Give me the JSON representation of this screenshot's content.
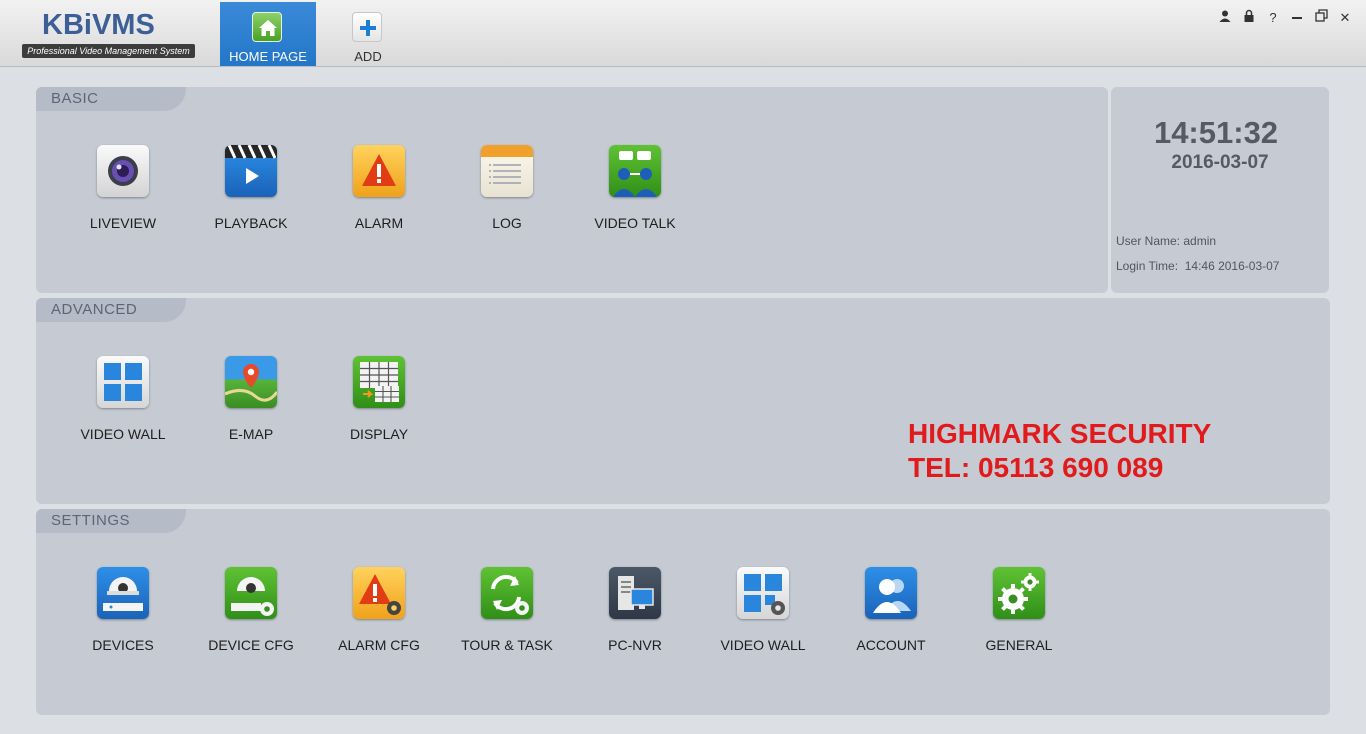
{
  "app": {
    "logo": "KBiVMS",
    "tagline": "Professional Video Management System"
  },
  "nav": {
    "home": "HOME PAGE",
    "add": "ADD"
  },
  "window_controls": [
    "user-icon",
    "lock-icon",
    "help-icon",
    "minimize-icon",
    "restore-icon",
    "close-icon"
  ],
  "basic": {
    "title": "BASIC",
    "items": [
      {
        "label": "LIVEVIEW",
        "icon": "camera-lens-icon"
      },
      {
        "label": "PLAYBACK",
        "icon": "clapper-play-icon"
      },
      {
        "label": "ALARM",
        "icon": "alarm-warning-icon"
      },
      {
        "label": "LOG",
        "icon": "log-notepad-icon"
      },
      {
        "label": "VIDEO TALK",
        "icon": "video-talk-icon"
      }
    ]
  },
  "advanced": {
    "title": "ADVANCED",
    "items": [
      {
        "label": "VIDEO WALL",
        "icon": "video-wall-icon"
      },
      {
        "label": "E-MAP",
        "icon": "map-pin-icon"
      },
      {
        "label": "DISPLAY",
        "icon": "display-grid-icon"
      }
    ]
  },
  "settings": {
    "title": "SETTINGS",
    "items": [
      {
        "label": "DEVICES",
        "icon": "dome-camera-icon"
      },
      {
        "label": "DEVICE CFG",
        "icon": "device-cfg-icon"
      },
      {
        "label": "ALARM CFG",
        "icon": "alarm-cfg-icon"
      },
      {
        "label": "TOUR & TASK",
        "icon": "tour-task-icon"
      },
      {
        "label": "PC-NVR",
        "icon": "pc-nvr-icon"
      },
      {
        "label": "VIDEO WALL",
        "icon": "video-wall-cfg-icon"
      },
      {
        "label": "ACCOUNT",
        "icon": "account-icon"
      },
      {
        "label": "GENERAL",
        "icon": "general-gears-icon"
      }
    ]
  },
  "status": {
    "time": "14:51:32",
    "date": "2016-03-07",
    "user_label": "User Name:",
    "user_value": "admin",
    "login_label": "Login Time:",
    "login_value": "14:46 2016-03-07"
  },
  "promo": {
    "line1": "HIGHMARK SECURITY",
    "line2": "TEL: 05113 690 089"
  },
  "colors": {
    "accent": "#2376c8",
    "panel": "#c5cad3",
    "promo": "#e11b1b"
  }
}
